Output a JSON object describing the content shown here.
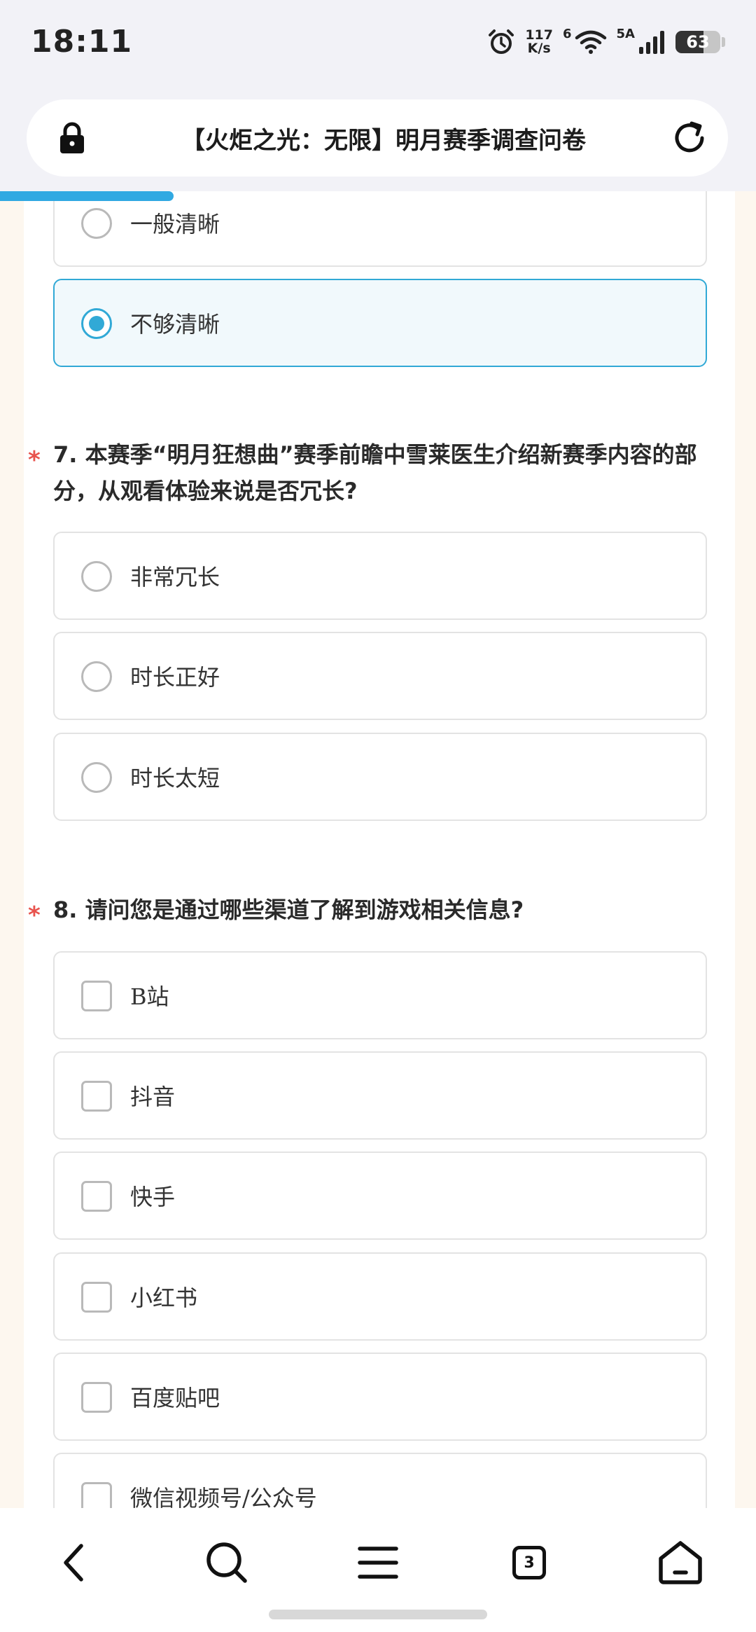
{
  "status_bar": {
    "time": "18:11",
    "net_speed_value": "117",
    "net_speed_unit": "K/s",
    "wifi_gen": "6",
    "cell_gen": "5A",
    "battery": "63",
    "battery_level": 0.63
  },
  "address_bar": {
    "title": "【火炬之光：无限】明月赛季调查问卷"
  },
  "page_load_progress": 0.23,
  "prev_question_options": [
    {
      "label": "一般清晰",
      "selected": false
    },
    {
      "label": "不够清晰",
      "selected": true
    }
  ],
  "question_7": {
    "required_mark": "*",
    "text": "7. 本赛季“明月狂想曲”赛季前瞻中雪莱医生介绍新赛季内容的部分，从观看体验来说是否冗长?",
    "options": [
      {
        "label": "非常冗长"
      },
      {
        "label": "时长正好"
      },
      {
        "label": "时长太短"
      }
    ]
  },
  "question_8": {
    "required_mark": "*",
    "text": "8. 请问您是通过哪些渠道了解到游戏相关信息?",
    "options": [
      {
        "label": "B站"
      },
      {
        "label": "抖音"
      },
      {
        "label": "快手"
      },
      {
        "label": "小红书"
      },
      {
        "label": "百度贴吧"
      },
      {
        "label": "微信视频号/公众号"
      }
    ]
  },
  "bottom_nav": {
    "tab_count": "3",
    "icons": [
      "back-icon",
      "search-icon",
      "menu-icon",
      "tabs-icon",
      "home-icon"
    ]
  },
  "colors": {
    "accent": "#31a9d6",
    "required": "#e8534d",
    "progress": "#31a9e2"
  }
}
